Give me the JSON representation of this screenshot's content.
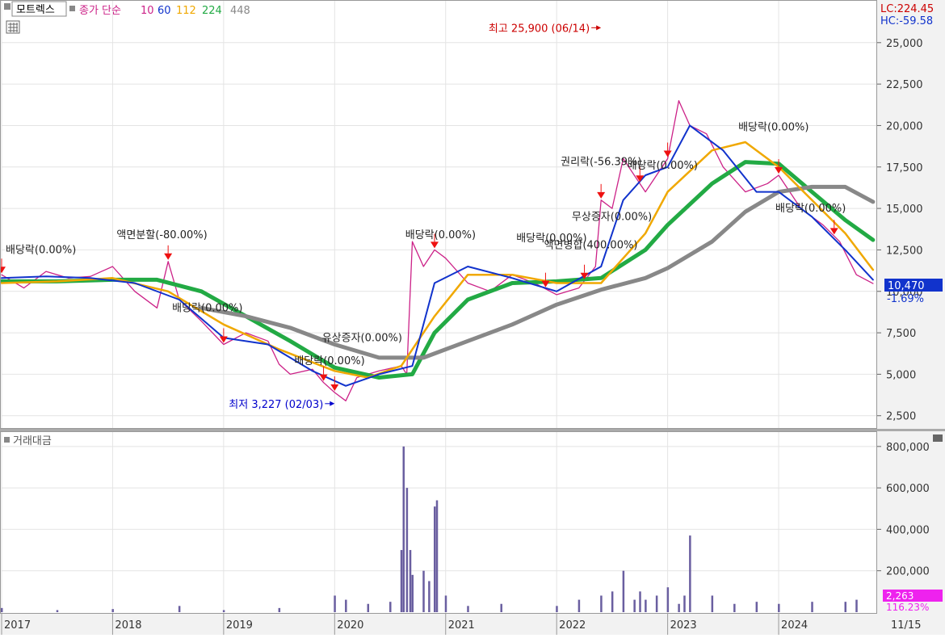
{
  "header": {
    "stock_name": "모트렉스",
    "indicator_label": "종가 단순",
    "ma_periods": [
      "10",
      "60",
      "112",
      "224",
      "448"
    ],
    "ma_colors": [
      "#dd22aa",
      "#1133cc",
      "#f0a800",
      "#22aa44",
      "#888888"
    ],
    "lc_label": "LC:224.45",
    "hc_label": "HC:-59.58"
  },
  "volume_panel": {
    "title": "거래대금",
    "last_value_label": "2,263",
    "last_change_label": "116.23%"
  },
  "price_badge": {
    "value": "10,470",
    "change": "-1.69%"
  },
  "chart_data": [
    {
      "type": "line",
      "title": "",
      "x_labels": [
        "2017",
        "2018",
        "2019",
        "2020",
        "2021",
        "2022",
        "2023",
        "2024",
        "11/15"
      ],
      "y_ticks": [
        "25,000",
        "22,500",
        "20,000",
        "17,500",
        "15,000",
        "12,500",
        "10,000",
        "7,500",
        "5,000",
        "2,500"
      ],
      "ylim": [
        2000,
        26500
      ],
      "grid": true,
      "series": [
        {
          "name": "종가",
          "color": "#cc2288",
          "x": [
            2017.0,
            2017.2,
            2017.4,
            2017.6,
            2017.8,
            2018.0,
            2018.2,
            2018.4,
            2018.5,
            2018.6,
            2018.8,
            2019.0,
            2019.2,
            2019.4,
            2019.5,
            2019.6,
            2019.8,
            2019.9,
            2020.0,
            2020.1,
            2020.2,
            2020.4,
            2020.6,
            2020.65,
            2020.7,
            2020.8,
            2020.9,
            2021.0,
            2021.2,
            2021.4,
            2021.6,
            2021.8,
            2022.0,
            2022.2,
            2022.35,
            2022.4,
            2022.5,
            2022.6,
            2022.8,
            2023.0,
            2023.1,
            2023.2,
            2023.35,
            2023.5,
            2023.7,
            2023.9,
            2024.0,
            2024.2,
            2024.4,
            2024.55,
            2024.7,
            2024.85
          ],
          "y": [
            11000,
            10200,
            11200,
            10800,
            10900,
            11500,
            10000,
            9000,
            11800,
            9500,
            8200,
            6800,
            7500,
            7000,
            5600,
            5000,
            5300,
            4500,
            3900,
            3400,
            4800,
            5200,
            5500,
            5000,
            13000,
            11500,
            12500,
            12000,
            10500,
            10000,
            11000,
            10500,
            9800,
            10200,
            11500,
            15500,
            15000,
            18000,
            16000,
            18000,
            21500,
            20000,
            19500,
            17500,
            16000,
            16500,
            17000,
            15000,
            14000,
            13000,
            11000,
            10470
          ]
        },
        {
          "name": "10",
          "color": "#1133cc",
          "x": [
            2017.0,
            2017.4,
            2017.8,
            2018.2,
            2018.6,
            2019.0,
            2019.4,
            2019.8,
            2020.1,
            2020.4,
            2020.7,
            2020.9,
            2021.2,
            2021.6,
            2022.0,
            2022.4,
            2022.6,
            2022.8,
            2023.0,
            2023.2,
            2023.5,
            2023.8,
            2024.0,
            2024.3,
            2024.6,
            2024.85
          ],
          "y": [
            10800,
            10900,
            10800,
            10500,
            9500,
            7200,
            6800,
            5200,
            4300,
            5000,
            5500,
            10500,
            11500,
            10800,
            10000,
            11500,
            15500,
            17000,
            17500,
            20000,
            18500,
            16000,
            16000,
            14500,
            12500,
            10700
          ]
        },
        {
          "name": "112",
          "color": "#f0a800",
          "x": [
            2017.0,
            2017.5,
            2018.0,
            2018.5,
            2019.0,
            2019.5,
            2020.0,
            2020.3,
            2020.6,
            2020.9,
            2021.2,
            2021.6,
            2022.0,
            2022.4,
            2022.8,
            2023.0,
            2023.4,
            2023.7,
            2024.0,
            2024.3,
            2024.6,
            2024.85
          ],
          "y": [
            10500,
            10600,
            10800,
            10000,
            8000,
            6500,
            5200,
            4800,
            5500,
            8500,
            11000,
            11000,
            10500,
            10500,
            13500,
            16000,
            18500,
            19000,
            17500,
            15500,
            13500,
            11300
          ]
        },
        {
          "name": "224",
          "color": "#22aa44",
          "x": [
            2017.0,
            2017.5,
            2018.0,
            2018.4,
            2018.8,
            2019.2,
            2019.6,
            2020.0,
            2020.4,
            2020.7,
            2020.9,
            2021.2,
            2021.6,
            2022.0,
            2022.4,
            2022.8,
            2023.0,
            2023.4,
            2023.7,
            2024.0,
            2024.3,
            2024.6,
            2024.85
          ],
          "y": [
            10600,
            10600,
            10700,
            10700,
            10000,
            8500,
            7000,
            5400,
            4800,
            5000,
            7500,
            9500,
            10500,
            10600,
            10800,
            12500,
            14000,
            16500,
            17800,
            17700,
            16000,
            14300,
            13100
          ]
        },
        {
          "name": "448",
          "color": "#888888",
          "x": [
            2018.8,
            2019.2,
            2019.6,
            2020.0,
            2020.4,
            2020.8,
            2021.2,
            2021.6,
            2022.0,
            2022.4,
            2022.8,
            2023.0,
            2023.4,
            2023.7,
            2024.0,
            2024.3,
            2024.6,
            2024.85
          ],
          "y": [
            9000,
            8500,
            7800,
            6800,
            6000,
            6000,
            7000,
            8000,
            9200,
            10100,
            10800,
            11400,
            13000,
            14800,
            16000,
            16300,
            16300,
            15400
          ]
        }
      ],
      "annotations": [
        {
          "text": "최고 25,900 (06/14)",
          "x": 2022.4,
          "y": 25900,
          "color": "#cc0000",
          "side": "left"
        },
        {
          "text": "최저 3,227 (02/03)",
          "x": 2020.0,
          "y": 3227,
          "color": "#0000cc",
          "side": "left"
        },
        {
          "text": "배당락(0.00%)",
          "x": 2017.0,
          "y": 12300,
          "color": "#222222"
        },
        {
          "text": "액면분할(-80.00%)",
          "x": 2018.0,
          "y": 13200,
          "color": "#222222"
        },
        {
          "text": "배당락(0.00%)",
          "x": 2018.5,
          "y": 8800,
          "color": "#222222"
        },
        {
          "text": "유상증자(0.00%)",
          "x": 2019.85,
          "y": 7000,
          "color": "#222222"
        },
        {
          "text": "배당락(0.00%)",
          "x": 2019.6,
          "y": 5600,
          "color": "#222222"
        },
        {
          "text": "배당락(0.00%)",
          "x": 2020.6,
          "y": 13200,
          "color": "#222222"
        },
        {
          "text": "배당락(0.00%)",
          "x": 2021.6,
          "y": 13000,
          "color": "#222222"
        },
        {
          "text": "액면병합(400.00%)",
          "x": 2021.85,
          "y": 12600,
          "color": "#222222"
        },
        {
          "text": "권리락(-56.39%)",
          "x": 2022.0,
          "y": 17600,
          "color": "#222222"
        },
        {
          "text": "배당락(0.00%)",
          "x": 2022.6,
          "y": 17400,
          "color": "#222222"
        },
        {
          "text": "무상증자(0.00%)",
          "x": 2022.1,
          "y": 14300,
          "color": "#222222"
        },
        {
          "text": "배당락(0.00%)",
          "x": 2023.6,
          "y": 19700,
          "color": "#222222"
        },
        {
          "text": "배당락(0.00%)",
          "x": 2024.15,
          "y": 14800,
          "color": "#222222"
        }
      ],
      "event_markers_x": [
        2017.0,
        2018.5,
        2019.0,
        2019.9,
        2020.0,
        2020.9,
        2021.9,
        2022.25,
        2022.4,
        2022.75,
        2023.0,
        2024.0,
        2024.5
      ]
    },
    {
      "type": "bar",
      "title": "거래대금",
      "y_ticks": [
        "800,000",
        "600,000",
        "400,000",
        "200,000"
      ],
      "ylim": [
        0,
        850000
      ],
      "color": "#6a5fa0",
      "x": [
        2017.0,
        2017.5,
        2018.0,
        2018.6,
        2019.0,
        2019.5,
        2020.0,
        2020.1,
        2020.3,
        2020.5,
        2020.6,
        2020.62,
        2020.65,
        2020.68,
        2020.7,
        2020.8,
        2020.85,
        2020.9,
        2020.92,
        2021.0,
        2021.2,
        2021.5,
        2022.0,
        2022.2,
        2022.4,
        2022.5,
        2022.6,
        2022.7,
        2022.75,
        2022.8,
        2022.9,
        2023.0,
        2023.1,
        2023.15,
        2023.2,
        2023.4,
        2023.6,
        2023.8,
        2024.0,
        2024.3,
        2024.6,
        2024.7
      ],
      "y": [
        20000,
        10000,
        15000,
        30000,
        10000,
        20000,
        80000,
        60000,
        40000,
        50000,
        300000,
        800000,
        600000,
        300000,
        180000,
        200000,
        150000,
        510000,
        540000,
        80000,
        30000,
        40000,
        30000,
        60000,
        80000,
        100000,
        200000,
        60000,
        100000,
        60000,
        80000,
        120000,
        40000,
        80000,
        370000,
        80000,
        40000,
        50000,
        40000,
        50000,
        50000,
        60000
      ]
    }
  ]
}
